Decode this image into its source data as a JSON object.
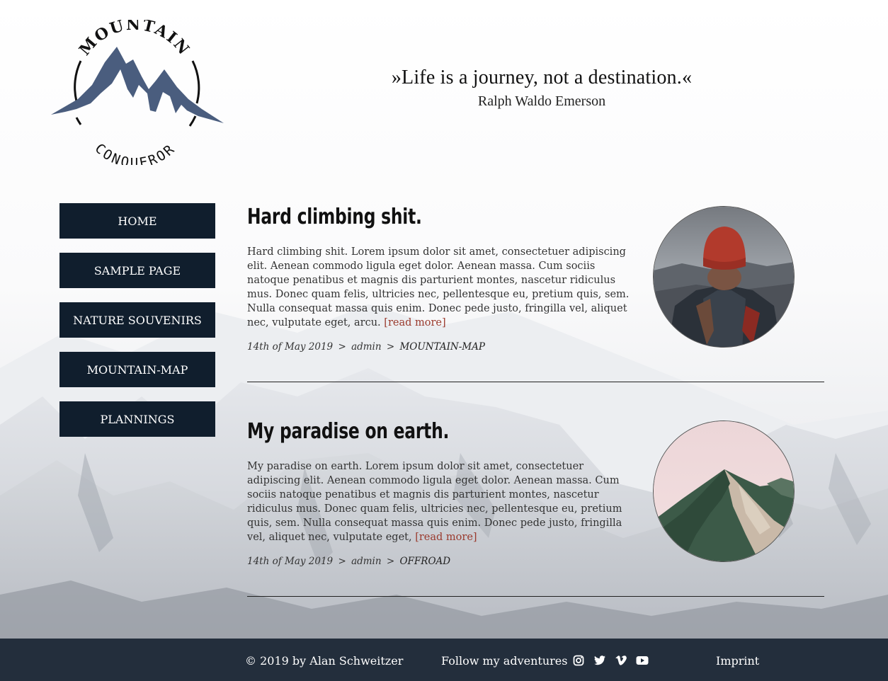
{
  "logo": {
    "top_text": "MOUNTAIN",
    "bottom_text": "CONQUEROR"
  },
  "quote": {
    "text": "»Life is a journey, not a destination.«",
    "author": "Ralph Waldo Emerson"
  },
  "nav": {
    "items": [
      {
        "label": "HOME"
      },
      {
        "label": "SAMPLE PAGE"
      },
      {
        "label": "NATURE SOUVENIRS"
      },
      {
        "label": "MOUNTAIN-MAP"
      },
      {
        "label": "PLANNINGS"
      }
    ]
  },
  "posts": [
    {
      "title": "Hard climbing shit.",
      "excerpt": "Hard climbing shit. Lorem ipsum dolor sit amet, consectetuer adipiscing elit. Aenean commodo ligula eget dolor. Aenean massa. Cum sociis natoque penatibus et magnis dis parturient montes, nascetur ridiculus mus. Donec quam felis, ultricies nec, pellentesque eu, pretium quis, sem. Nulla consequat massa quis enim. Donec pede justo, fringilla vel, aliquet nec, vulputate eget, arcu.",
      "read_more": "[read more]",
      "date": "14th of May 2019",
      "sep": ">",
      "author": "admin",
      "category": "MOUNTAIN-MAP",
      "image": "hiker-red-beanie-photo"
    },
    {
      "title": "My paradise on earth.",
      "excerpt": "My paradise on earth. Lorem ipsum dolor sit amet, consectetuer adipiscing elit. Aenean commodo ligula eget dolor. Aenean massa. Cum sociis natoque penatibus et magnis dis parturient montes, nascetur ridiculus mus. Donec quam felis, ultricies nec, pellentesque eu, pretium quis, sem. Nulla consequat massa quis enim. Donec pede justo, fringilla vel, aliquet nec, vulputate eget,",
      "read_more": "[read more]",
      "date": "14th of May 2019",
      "sep": ">",
      "author": "admin",
      "category": "OFFROAD",
      "image": "green-mountain-peak-photo"
    }
  ],
  "footer": {
    "copyright": "© 2019 by Alan Schweitzer",
    "follow": "Follow my adventures",
    "social": [
      "instagram-icon",
      "twitter-icon",
      "vimeo-icon",
      "youtube-icon"
    ],
    "imprint": "Imprint"
  },
  "colors": {
    "nav_bg": "#101e2d",
    "footer_bg": "#1c2836",
    "link": "#9a3a2d",
    "logo_mountain": "#4a5d7e"
  }
}
